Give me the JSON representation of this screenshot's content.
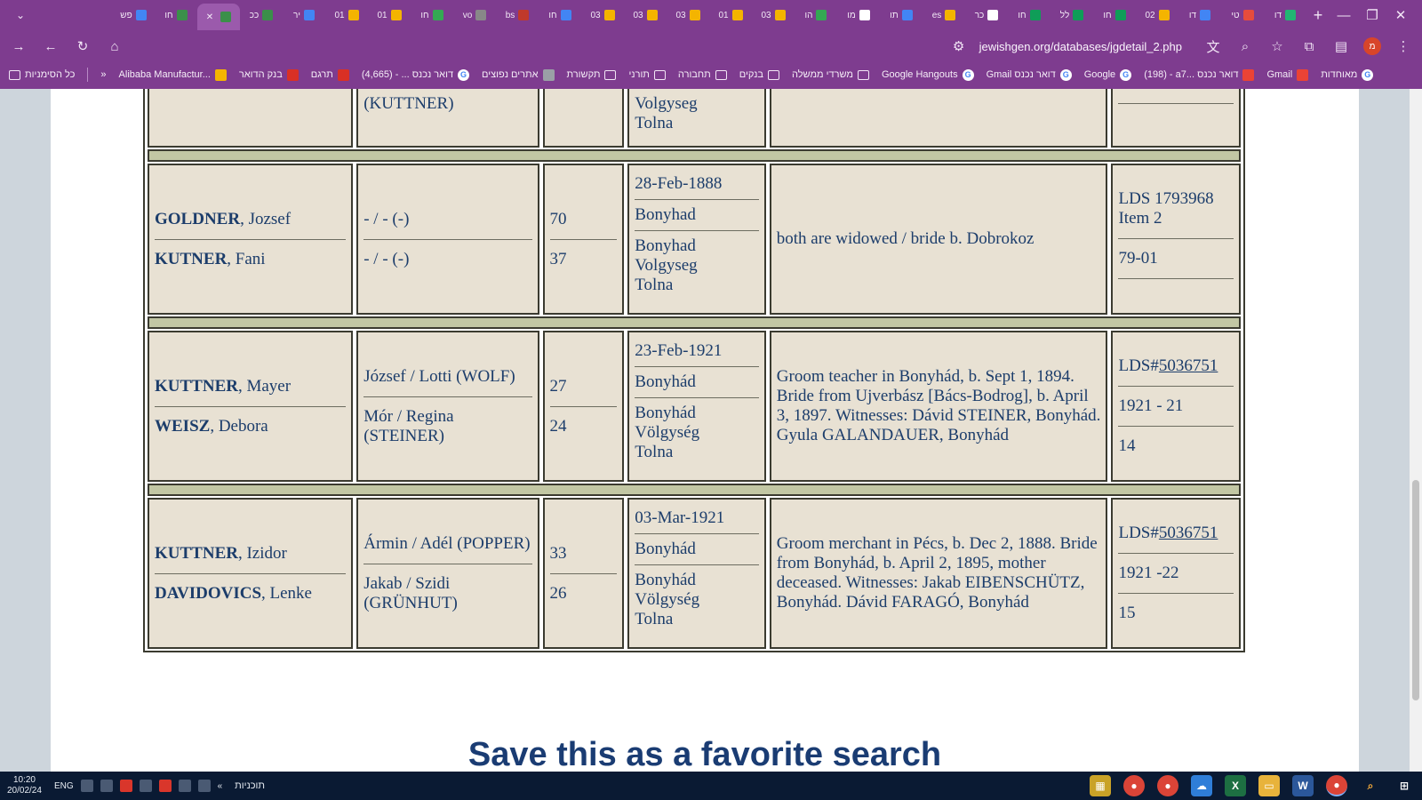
{
  "browser": {
    "url": "jewishgen.org/databases/jgdetail_2.php",
    "tabs": [
      {
        "label": "דו",
        "color": "#22b573"
      },
      {
        "label": "טי",
        "color": "#e74c3c"
      },
      {
        "label": "דו",
        "color": "#4285f4"
      },
      {
        "label": "02",
        "color": "#f4b400"
      },
      {
        "label": "חו",
        "color": "#0f9d58"
      },
      {
        "label": "לל",
        "color": "#0f9d58"
      },
      {
        "label": "חו",
        "color": "#0f9d58"
      },
      {
        "label": "כר",
        "color": "#ffffff"
      },
      {
        "label": "es",
        "color": "#f4b400"
      },
      {
        "label": "תו",
        "color": "#4285f4"
      },
      {
        "label": "מו",
        "color": "#ffffff"
      },
      {
        "label": "הו",
        "color": "#34a853"
      },
      {
        "label": "03",
        "color": "#f4b400"
      },
      {
        "label": "01",
        "color": "#f4b400"
      },
      {
        "label": "03",
        "color": "#f4b400"
      },
      {
        "label": "03",
        "color": "#f4b400"
      },
      {
        "label": "03",
        "color": "#f4b400"
      },
      {
        "label": "חו",
        "color": "#4285f4"
      },
      {
        "label": "bs",
        "color": "#c0392b"
      },
      {
        "label": "vo",
        "color": "#888888"
      },
      {
        "label": "חו",
        "color": "#34a853"
      },
      {
        "label": "01",
        "color": "#f4b400"
      },
      {
        "label": "01",
        "color": "#f4b400"
      },
      {
        "label": "יר",
        "color": "#4285f4"
      },
      {
        "label": "ככ",
        "color": "#3b8f4a"
      },
      {
        "label": "",
        "color": "#3b8f4a",
        "active": true
      },
      {
        "label": "חו",
        "color": "#3b8f4a"
      },
      {
        "label": "פש",
        "color": "#4285f4"
      }
    ],
    "bookmarks": [
      {
        "label": "מאוחדות",
        "type": "google"
      },
      {
        "label": "Gmail",
        "type": "gmail"
      },
      {
        "label": "(198) - a7... דואר נכנס",
        "type": "gmail"
      },
      {
        "label": "Google",
        "type": "google"
      },
      {
        "label": "Gmail דואר נכנס",
        "type": "google"
      },
      {
        "label": "Google Hangouts",
        "type": "google"
      },
      {
        "label": "משרדי ממשלה",
        "type": "folder"
      },
      {
        "label": "בנקים",
        "type": "folder"
      },
      {
        "label": "תחבורה",
        "type": "folder"
      },
      {
        "label": "תורני",
        "type": "folder"
      },
      {
        "label": "תקשורת",
        "type": "folder"
      },
      {
        "label": "אתרים נפוצים",
        "type": "shield"
      },
      {
        "label": "(4,665) - ... דואר נכנס",
        "type": "google"
      },
      {
        "label": "תרגם",
        "type": "red"
      },
      {
        "label": "בנק הדואר",
        "type": "red"
      },
      {
        "label": "Alibaba Manufactur...",
        "type": "orange"
      }
    ],
    "all_bookmarks": "כל הסימניות"
  },
  "records": {
    "first_partial": {
      "parents": "(KUTTNER)",
      "place": [
        "Volgyseg",
        "Tolna"
      ]
    },
    "rows": [
      {
        "groom_surname": "GOLDNER",
        "groom_given": ", Jozsef",
        "bride_surname": "KUTNER",
        "bride_given": ", Fani",
        "groom_parents": "- / - (-)",
        "bride_parents": "- / - (-)",
        "groom_age": "70",
        "bride_age": "37",
        "date": "28-Feb-1888",
        "groom_place": "Bonyhad",
        "bride_place": [
          "Bonyhad",
          "Volgyseg",
          "Tolna"
        ],
        "notes": "both are widowed / bride b. Dobrokoz",
        "source_prefix": "LDS 1793968 Item 2",
        "source_link": "",
        "source_line2": "79-01",
        "source_line3": ""
      },
      {
        "groom_surname": "KUTTNER",
        "groom_given": ", Mayer",
        "bride_surname": "WEISZ",
        "bride_given": ", Debora",
        "groom_parents": "József / Lotti (WOLF)",
        "bride_parents": "Mór / Regina (STEINER)",
        "groom_age": "27",
        "bride_age": "24",
        "date": "23-Feb-1921",
        "groom_place": "Bonyhád",
        "bride_place": [
          "Bonyhád",
          "Völgység",
          "Tolna"
        ],
        "notes": "Groom teacher in Bonyhád, b. Sept 1, 1894. Bride from Ujverbász [Bács-Bodrog], b. April 3, 1897. Witnesses: Dávid STEINER, Bonyhád. Gyula GALANDAUER, Bonyhád",
        "source_prefix": "LDS#",
        "source_link": "5036751",
        "source_line2": "1921 - 21",
        "source_line3": "14"
      },
      {
        "groom_surname": "KUTTNER",
        "groom_given": ", Izidor",
        "bride_surname": "DAVIDOVICS",
        "bride_given": ", Lenke",
        "groom_parents": "Ármin / Adél (POPPER)",
        "bride_parents": "Jakab / Szidi (GRÜNHUT)",
        "groom_age": "33",
        "bride_age": "26",
        "date": "03-Mar-1921",
        "groom_place": "Bonyhád",
        "bride_place": [
          "Bonyhád",
          "Völgység",
          "Tolna"
        ],
        "notes": "Groom merchant in Pécs, b. Dec 2, 1888. Bride from Bonyhád, b. April 2, 1895, mother deceased. Witnesses: Jakab EIBENSCHÜTZ, Bonyhád. Dávid FARAGÓ, Bonyhád",
        "source_prefix": "LDS#",
        "source_link": "5036751",
        "source_line2": "1921 -22",
        "source_line3": "15"
      }
    ]
  },
  "save_heading": "Save this as a favorite search",
  "taskbar": {
    "time": "10:20",
    "date": "20/02/24",
    "lang": "ENG",
    "label": "תוכניות"
  },
  "colors": {
    "chrome": "#7e3c8f",
    "cell_bg": "#e8e1d3",
    "divider": "#c2c7a4",
    "text": "#1c3d6b"
  }
}
